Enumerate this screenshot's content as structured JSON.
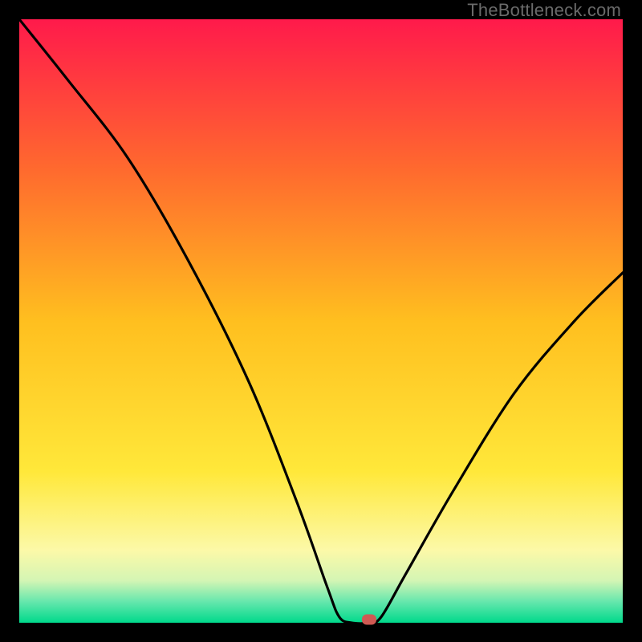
{
  "watermark": "TheBottleneck.com",
  "chart_data": {
    "type": "line",
    "title": "",
    "xlabel": "",
    "ylabel": "",
    "xlim": [
      0,
      100
    ],
    "ylim": [
      0,
      100
    ],
    "grid": false,
    "legend": false,
    "background_gradient": {
      "stops": [
        {
          "offset": 0.0,
          "color": "#ff1a4b"
        },
        {
          "offset": 0.25,
          "color": "#ff6a2e"
        },
        {
          "offset": 0.5,
          "color": "#ffbf1f"
        },
        {
          "offset": 0.75,
          "color": "#ffe83a"
        },
        {
          "offset": 0.88,
          "color": "#fcf9a8"
        },
        {
          "offset": 0.93,
          "color": "#d4f5b4"
        },
        {
          "offset": 0.965,
          "color": "#66e7ad"
        },
        {
          "offset": 1.0,
          "color": "#00d98b"
        }
      ]
    },
    "series": [
      {
        "name": "bottleneck-curve",
        "points": [
          {
            "x": 0,
            "y": 100
          },
          {
            "x": 8,
            "y": 90
          },
          {
            "x": 18,
            "y": 77
          },
          {
            "x": 28,
            "y": 60
          },
          {
            "x": 38,
            "y": 40
          },
          {
            "x": 46,
            "y": 20
          },
          {
            "x": 51,
            "y": 6
          },
          {
            "x": 53,
            "y": 1
          },
          {
            "x": 55,
            "y": 0
          },
          {
            "x": 58,
            "y": 0
          },
          {
            "x": 60,
            "y": 1
          },
          {
            "x": 64,
            "y": 8
          },
          {
            "x": 72,
            "y": 22
          },
          {
            "x": 82,
            "y": 38
          },
          {
            "x": 92,
            "y": 50
          },
          {
            "x": 100,
            "y": 58
          }
        ]
      }
    ],
    "marker": {
      "x": 58,
      "y": 0,
      "color": "#cf5a53"
    }
  }
}
